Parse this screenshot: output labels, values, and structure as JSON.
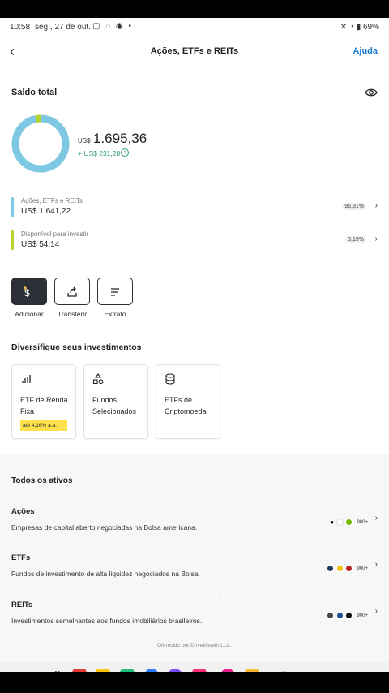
{
  "status_bar": {
    "time": "10:58",
    "date": "seg., 27 de out.",
    "right": "69%"
  },
  "header": {
    "back_icon": "chevron-left-icon",
    "title": "Ações, ETFs e REITs",
    "help": "Ajuda"
  },
  "balance": {
    "label": "Saldo total",
    "currency": "US$",
    "amount": "1.695,36",
    "gain": "+ US$ 231,28",
    "donut": {
      "invested_fraction": 0.9681,
      "available_fraction": 0.0319,
      "invested_color": "#7ec8e3",
      "available_color": "#b7d433"
    }
  },
  "allocations": [
    {
      "name": "Ações, ETFs e REITs",
      "value": "US$ 1.641,22",
      "percent": "96,81%",
      "color": "#7ec8e3"
    },
    {
      "name": "Disponível para investir",
      "value": "US$ 54,14",
      "percent": "3,19%",
      "color": "#b7d433"
    }
  ],
  "actions": [
    {
      "label": "Adicionar",
      "icon": "add-money-icon"
    },
    {
      "label": "Transferir",
      "icon": "share-icon"
    },
    {
      "label": "Extrato",
      "icon": "list-icon"
    }
  ],
  "diversify": {
    "title": "Diversifique seus investimentos",
    "cards": [
      {
        "label": "ETF de Renda Fixa",
        "badge": "até 4,16% a.a.",
        "icon": "bar-chart-icon"
      },
      {
        "label": "Fundos Selecionados",
        "icon": "shapes-icon"
      },
      {
        "label": "ETFs de Criptomoeda",
        "icon": "database-icon"
      }
    ]
  },
  "all_assets": {
    "title": "Todos os ativos",
    "items": [
      {
        "name": "Ações",
        "description": "Empresas de capital aberto negociadas na Bolsa americana.",
        "more": "900+"
      },
      {
        "name": "ETFs",
        "description": "Fundos de investimento de alta liquidez negociados na Bolsa.",
        "more": "900+"
      },
      {
        "name": "REITs",
        "description": "Investimentos semelhantes aos fundos imobiliários brasileiros.",
        "more": "900+"
      }
    ]
  },
  "footer": {
    "offered_by": "Oferecido por DriveWealth LLC."
  },
  "watermark": "@juliaperesvestfinances"
}
